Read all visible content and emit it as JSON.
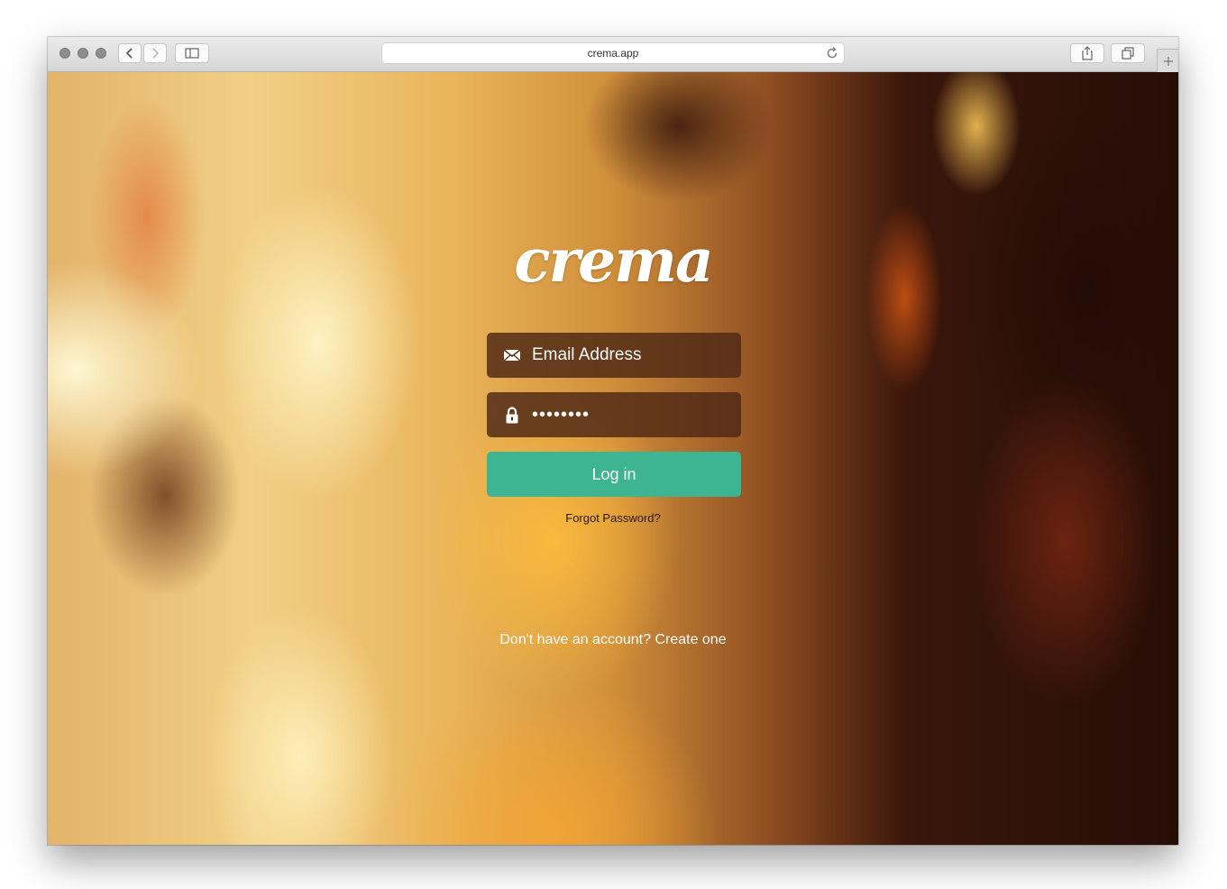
{
  "browser": {
    "url": "crema.app",
    "icons": {
      "back": "chevron-left-icon",
      "forward": "chevron-right-icon",
      "sidebar": "sidebar-icon",
      "reload": "reload-icon",
      "share": "share-icon",
      "tabs": "tabs-icon",
      "new_tab": "plus-icon"
    }
  },
  "login": {
    "logo_text": "crema",
    "email_placeholder": "Email Address",
    "password_value": "••••••••",
    "login_label": "Log in",
    "forgot_password": "Forgot Password?",
    "signup_prompt": "Don't have an account? Create one"
  },
  "colors": {
    "accent": "#3db593",
    "field_background": "#502a16",
    "text": "#ffffff"
  }
}
